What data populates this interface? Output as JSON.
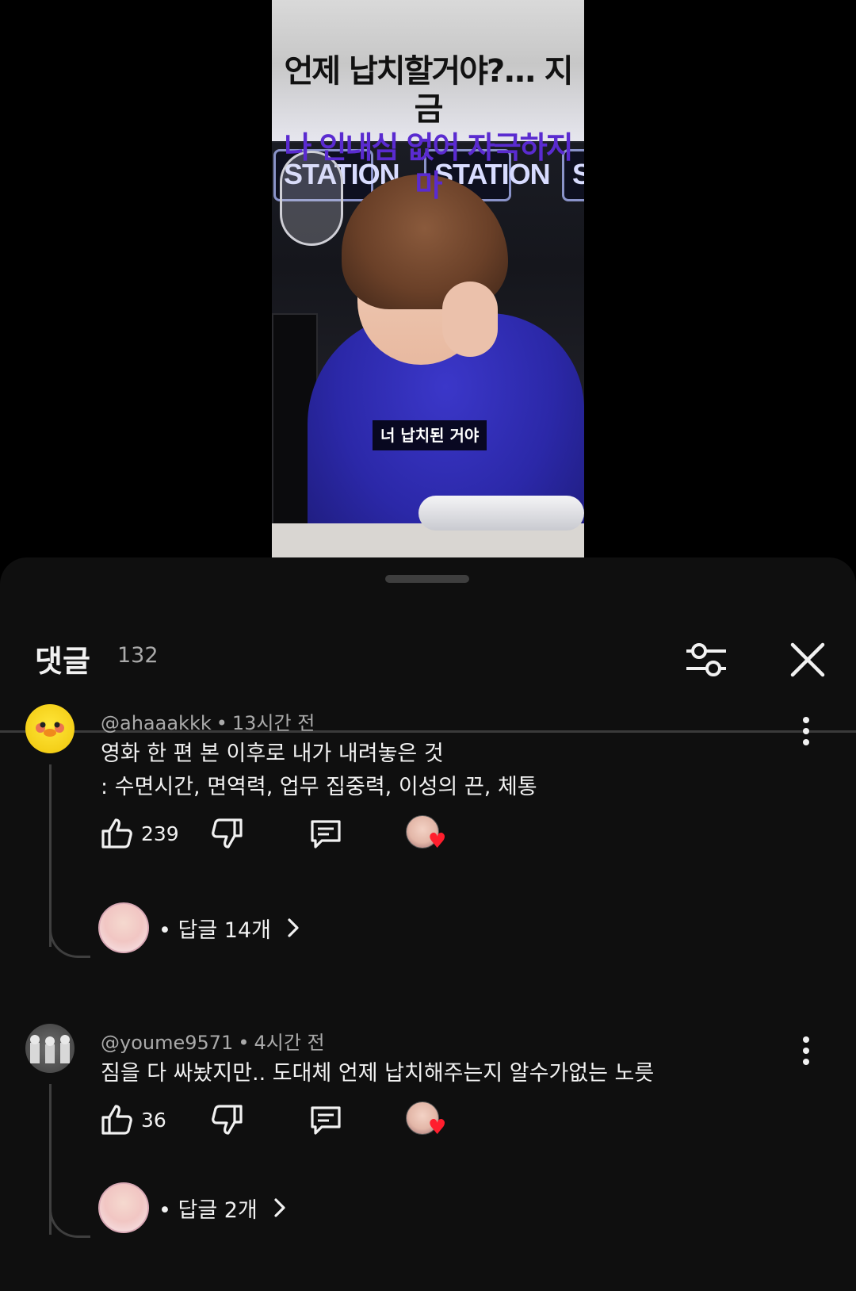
{
  "video": {
    "title_line1": "언제 납치할거야?... 지금",
    "title_line2": "나 인내심 없어 자극하지마",
    "station_signs": [
      "STATION",
      "STATION",
      "ST"
    ],
    "subtitle": "너 납치된 거야"
  },
  "comments_panel": {
    "title": "댓글",
    "count": "132",
    "filter_icon": "sliders-icon",
    "close_icon": "close-icon"
  },
  "comments": [
    {
      "author": "@ahaaakkk",
      "time": "13시간 전",
      "line1": "영화 한 편 본 이후로 내가 내려놓은 것",
      "line2": ": 수면시간, 면역력, 업무 집중력, 이성의 끈, 체통",
      "likes": "239",
      "replies": "답글 14개",
      "creator_hearted": true
    },
    {
      "author": "@youme9571",
      "time": "4시간 전",
      "line1": "짐을 다 싸놨지만.. 도대체 언제 납치해주는지 알수가없는 노릇",
      "likes": "36",
      "replies": "답글 2개",
      "creator_hearted": true
    }
  ],
  "colors": {
    "background": "#0f0f0f",
    "text": "#f1f1f1",
    "muted": "#aaaaaa",
    "heart": "#ff1e2d",
    "title_purple": "#5a2bd0"
  }
}
